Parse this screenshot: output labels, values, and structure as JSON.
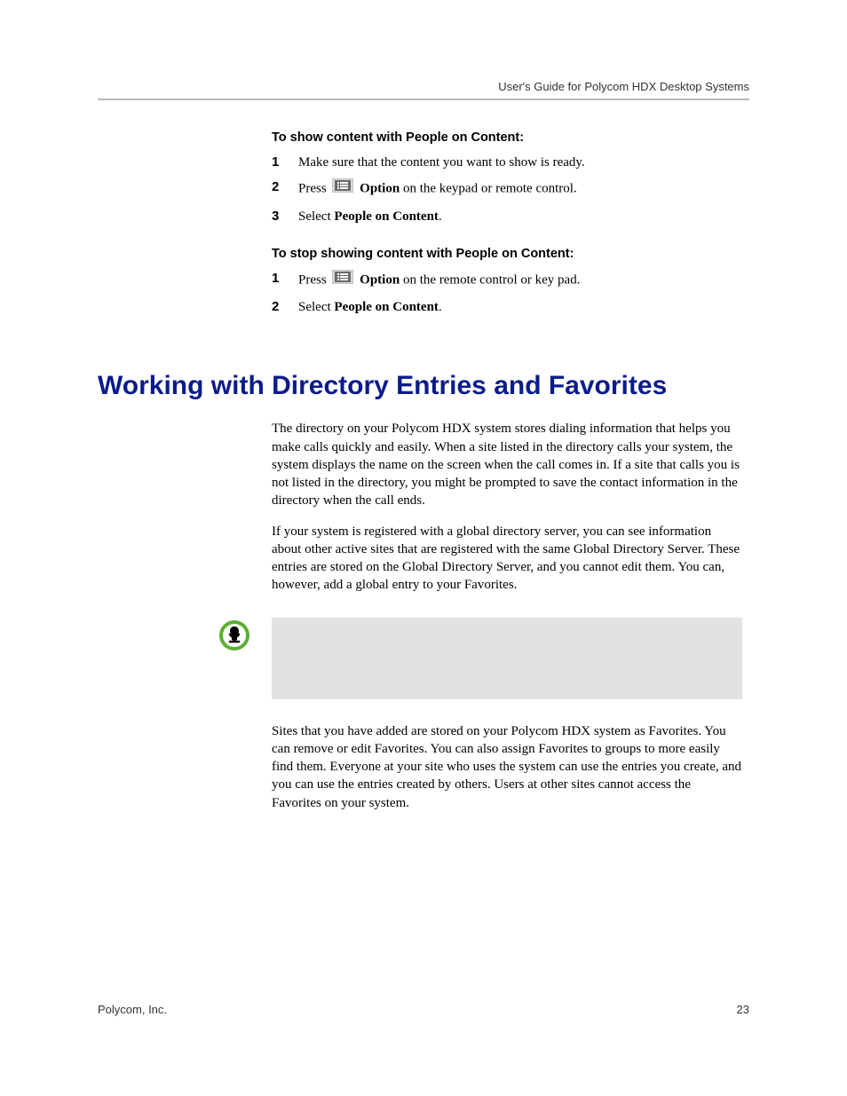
{
  "header": {
    "doc_title": "User's Guide for Polycom HDX Desktop Systems"
  },
  "section1": {
    "title": "To show content with People on Content:",
    "steps": [
      {
        "num": "1",
        "text": "Make sure that the content you want to show is ready."
      },
      {
        "num": "2",
        "pre": "Press ",
        "icon": "option-icon",
        "bold": "Option",
        "post": " on the keypad or remote control."
      },
      {
        "num": "3",
        "pre": "Select ",
        "bold": "People on Content",
        "post": "."
      }
    ]
  },
  "section2": {
    "title": "To stop showing content with People on Content:",
    "steps": [
      {
        "num": "1",
        "pre": "Press ",
        "icon": "option-icon",
        "bold": "Option",
        "post": " on the remote control or key pad."
      },
      {
        "num": "2",
        "pre": "Select ",
        "bold": "People on Content",
        "post": "."
      }
    ]
  },
  "heading": "Working with Directory Entries and Favorites",
  "p1": "The directory on your Polycom HDX system stores dialing information that helps you make calls quickly and easily. When a site listed in the directory calls your system, the system displays the name on the screen when the call comes in. If a site that calls you is not listed in the directory, you might be prompted to save the contact information in the directory when the call ends.",
  "p2": "If your system is registered with a global directory server, you can see information about other active sites that are registered with the same Global Directory Server. These entries are stored on the Global Directory Server, and you cannot edit them. You can, however, add a global entry to your Favorites.",
  "p3": "Sites that you have added are stored on your Polycom HDX system as Favorites. You can remove or edit Favorites. You can also assign Favorites to groups to more easily find them. Everyone at your site who uses the system can use the entries you create, and you can use the entries created by others. Users at other sites cannot access the Favorites on your system.",
  "footer": {
    "left": "Polycom, Inc.",
    "right": "23"
  }
}
